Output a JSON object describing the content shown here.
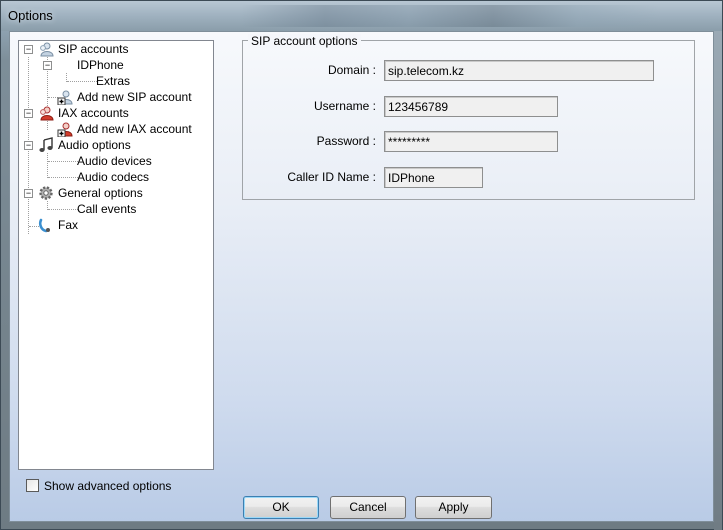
{
  "window": {
    "title": "Options"
  },
  "tree": {
    "items": [
      {
        "label": "SIP accounts",
        "level": 0,
        "expander": "−",
        "icon": "sip-accounts-icon"
      },
      {
        "label": "IDPhone",
        "level": 1,
        "expander": "−",
        "icon": ""
      },
      {
        "label": "Extras",
        "level": 2,
        "expander": "",
        "icon": ""
      },
      {
        "label": "Add new SIP account",
        "level": 1,
        "expander": "",
        "icon": "add-sip-account-icon"
      },
      {
        "label": "IAX accounts",
        "level": 0,
        "expander": "−",
        "icon": "iax-accounts-icon"
      },
      {
        "label": "Add new IAX account",
        "level": 1,
        "expander": "",
        "icon": "add-iax-account-icon"
      },
      {
        "label": "Audio options",
        "level": 0,
        "expander": "−",
        "icon": "audio-options-icon"
      },
      {
        "label": "Audio devices",
        "level": 1,
        "expander": "",
        "icon": ""
      },
      {
        "label": "Audio codecs",
        "level": 1,
        "expander": "",
        "icon": ""
      },
      {
        "label": "General options",
        "level": 0,
        "expander": "−",
        "icon": "gear-icon"
      },
      {
        "label": "Call events",
        "level": 1,
        "expander": "",
        "icon": ""
      },
      {
        "label": "Fax",
        "level": 0,
        "expander": "",
        "icon": "fax-icon"
      }
    ]
  },
  "sip_options": {
    "group_title": "SIP account options",
    "domain_label": "Domain :",
    "domain_value": "sip.telecom.kz",
    "username_label": "Username :",
    "username_value": "123456789",
    "password_label": "Password :",
    "password_value": "*********",
    "callerid_label": "Caller ID Name :",
    "callerid_value": "IDPhone"
  },
  "advanced": {
    "label": "Show advanced options",
    "checked": false
  },
  "buttons": {
    "ok": "OK",
    "cancel": "Cancel",
    "apply": "Apply"
  }
}
